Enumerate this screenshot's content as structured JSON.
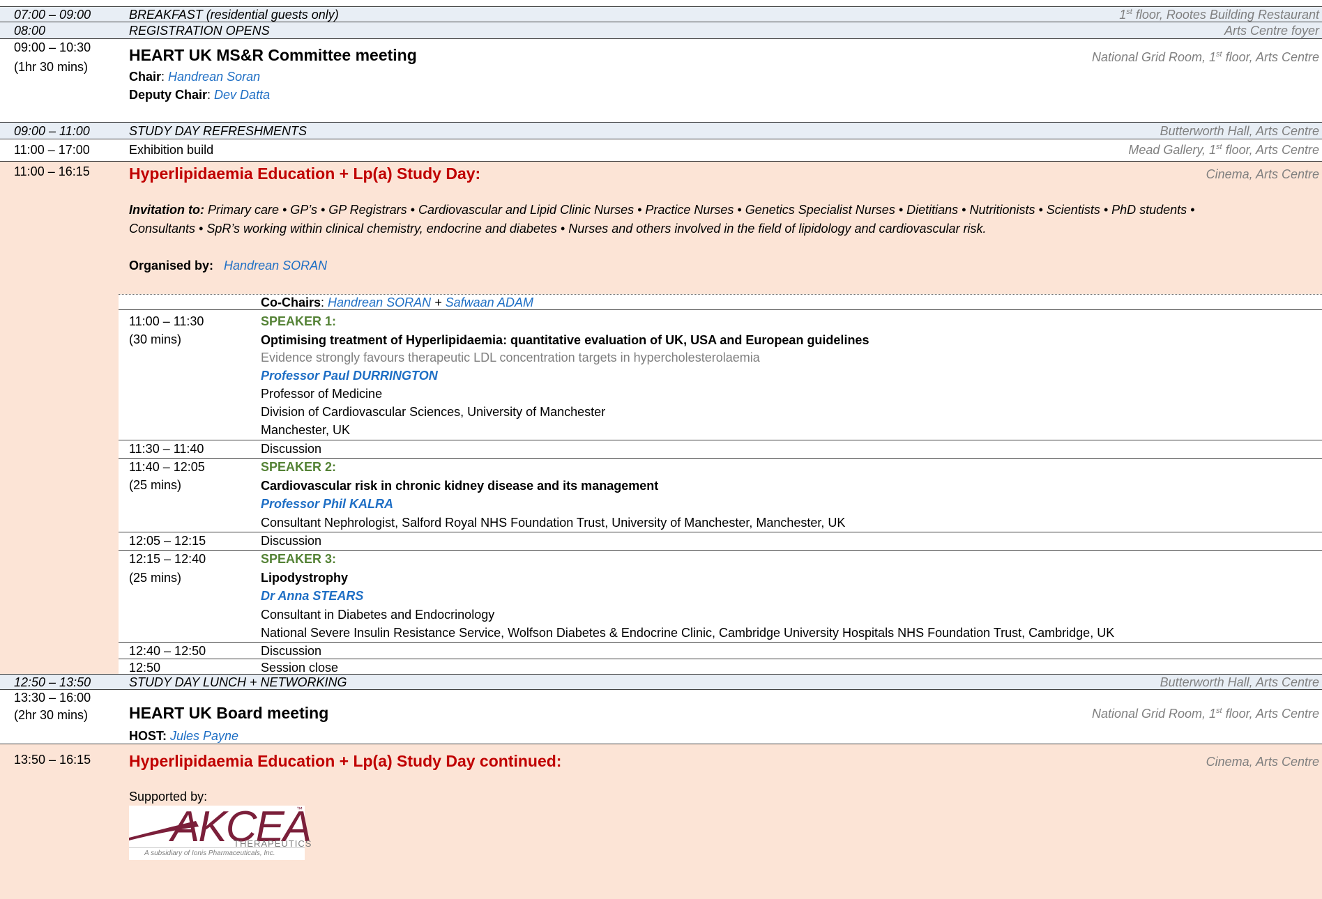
{
  "rows": {
    "breakfast": {
      "time": "07:00 – 09:00",
      "title": "BREAKFAST (residential guests only)",
      "loc_pre": "1",
      "loc_sup": "st",
      "loc_post": " floor, Rootes Building Restaurant"
    },
    "registration": {
      "time": "08:00",
      "title": "REGISTRATION OPENS",
      "loc": "Arts Centre foyer"
    },
    "msr": {
      "time": "09:00 – 10:30",
      "duration": "(1hr 30 mins)",
      "title": "HEART UK MS&R Committee meeting",
      "loc_pre": "National Grid Room, 1",
      "loc_sup": "st",
      "loc_post": " floor, Arts Centre",
      "chair_label": "Chair",
      "chair": "Handrean Soran",
      "deputy_label": "Deputy Chair",
      "deputy": "Dev Datta",
      "sep": ": "
    },
    "refreshments": {
      "time": "09:00 – 11:00",
      "title": "STUDY DAY REFRESHMENTS",
      "loc": "Butterworth Hall, Arts Centre"
    },
    "exhibition": {
      "time": "11:00 – 17:00",
      "title": "Exhibition build",
      "loc_pre": "Mead Gallery, 1",
      "loc_sup": "st",
      "loc_post": " floor, Arts Centre"
    },
    "studyday": {
      "time": "11:00 – 16:15",
      "title": "Hyperlipidaemia Education + Lp(a) Study Day:",
      "loc": "Cinema, Arts Centre",
      "invitation_label": "Invitation to:",
      "invitation_line1": "  Primary care • GP’s • GP Registrars • Cardiovascular and Lipid Clinic Nurses • Practice Nurses • Genetics Specialist Nurses • Dietitians • Nutritionists • Scientists • PhD students •",
      "invitation_line2": "Consultants • SpR’s working within clinical chemistry, endocrine and diabetes • Nurses and others involved in the field of lipidology and cardiovascular risk.",
      "organised_label": "Organised by:",
      "organiser": "Handrean SORAN",
      "cochairs_label": "Co-Chairs",
      "cochair1": "Handrean SORAN",
      "cochair_join": "  + ",
      "cochair2": "Safwaan ADAM"
    }
  },
  "session": [
    {
      "time": "11:00 – 11:30",
      "duration": "(30 mins)",
      "speaker_label": "SPEAKER 1:",
      "talk": "Optimising treatment of Hyperlipidaemia: quantitative evaluation of UK, USA and European guidelines",
      "subtitle": "Evidence strongly favours therapeutic LDL concentration targets in hypercholesterolaemia",
      "speaker": "Professor Paul DURRINGTON",
      "aff1": "Professor of Medicine",
      "aff2": "Division of Cardiovascular Sciences, University of Manchester",
      "aff3": "Manchester, UK"
    },
    {
      "time": "11:30 – 11:40",
      "label": "Discussion"
    },
    {
      "time": "11:40 – 12:05",
      "duration": "(25 mins)",
      "speaker_label": "SPEAKER 2:",
      "talk": "Cardiovascular risk in chronic kidney disease and its management",
      "speaker": "Professor Phil KALRA",
      "aff1": "Consultant Nephrologist, Salford Royal NHS Foundation Trust, University of Manchester, Manchester, UK"
    },
    {
      "time": "12:05 – 12:15",
      "label": "Discussion"
    },
    {
      "time": "12:15 – 12:40",
      "duration": "(25 mins)",
      "speaker_label": "SPEAKER 3:",
      "talk": "Lipodystrophy",
      "speaker": "Dr Anna STEARS",
      "aff1": "Consultant in Diabetes and Endocrinology",
      "aff2": "National Severe Insulin Resistance Service, Wolfson Diabetes & Endocrine Clinic, Cambridge University Hospitals NHS Foundation Trust, Cambridge, UK"
    },
    {
      "time": "12:40 – 12:50",
      "label": "Discussion"
    },
    {
      "time": "12:50",
      "label": "Session close"
    }
  ],
  "rows2": {
    "lunch": {
      "time": "12:50 – 13:50",
      "title": "STUDY DAY LUNCH + NETWORKING",
      "loc": "Butterworth Hall, Arts Centre"
    },
    "board": {
      "time": "13:30 – 16:00",
      "duration": "(2hr 30 mins)",
      "title": "HEART UK Board meeting",
      "loc_pre": "National Grid Room, 1",
      "loc_sup": "st",
      "loc_post": " floor, Arts Centre",
      "host_label": "HOST:",
      "host": " Jules Payne"
    },
    "continued": {
      "time": "13:50 – 16:15",
      "title": "Hyperlipidaemia Education + Lp(a) Study Day continued:",
      "loc": "Cinema, Arts Centre",
      "supported_by": "Supported by:"
    }
  },
  "sponsor": {
    "name": "AKCEA",
    "tm": "™",
    "sub": "THERAPEUTICS",
    "tagline": "A subsidiary of Ionis Pharmaceuticals, Inc.",
    "color": "#7b1f3a"
  },
  "colors": {
    "accent_blue": "#1f6fc5",
    "title_red": "#c00000",
    "speaker_green": "#548235",
    "pink_bg": "#fce4d6",
    "bar_bg": "#e8eef5"
  }
}
